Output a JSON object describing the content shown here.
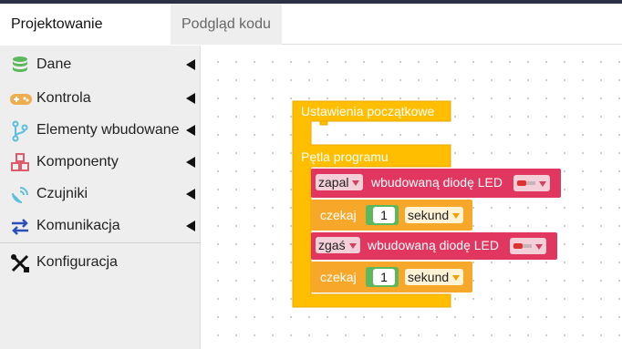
{
  "tabs": [
    {
      "label": "Projektowanie blokowe",
      "active": true
    },
    {
      "label": "Podgląd kodu",
      "active": false
    }
  ],
  "sidebar": {
    "items": [
      {
        "label": "Dane",
        "icon": "database-icon",
        "color": "#5cb85c"
      },
      {
        "label": "Kontrola",
        "icon": "gamepad-icon",
        "color": "#f0ad4e"
      },
      {
        "label": "Elementy wbudowane",
        "icon": "branch-icon",
        "color": "#5bc0de"
      },
      {
        "label": "Komponenty",
        "icon": "cubes-icon",
        "color": "#e05a6e"
      },
      {
        "label": "Czujniki",
        "icon": "satellite-dish-icon",
        "color": "#5bc0de"
      },
      {
        "label": "Komunikacja",
        "icon": "exchange-arrows-icon",
        "color": "#2b4fb8"
      },
      {
        "label": "Konfiguracja",
        "icon": "tools-icon",
        "color": "#111111"
      }
    ]
  },
  "blocks": {
    "setup_label": "Ustawienia początkowe",
    "loop_label": "Pętla programu",
    "statements": [
      {
        "type": "led",
        "state": "zapal",
        "label": "wbudowaną diodę LED",
        "led_icon": "led-icon"
      },
      {
        "type": "wait",
        "label": "czekaj",
        "value": "1",
        "unit": "sekund"
      },
      {
        "type": "led",
        "state": "zgaś",
        "label": "wbudowaną diodę LED",
        "led_icon": "led-icon"
      },
      {
        "type": "wait",
        "label": "czekaj",
        "value": "1",
        "unit": "sekund"
      }
    ]
  },
  "colors": {
    "control": "#ffbe00",
    "control_dark": "#e9a800",
    "led_block": "#e0365f",
    "wait_block": "#f7a82a",
    "number": "#5cb85c"
  }
}
